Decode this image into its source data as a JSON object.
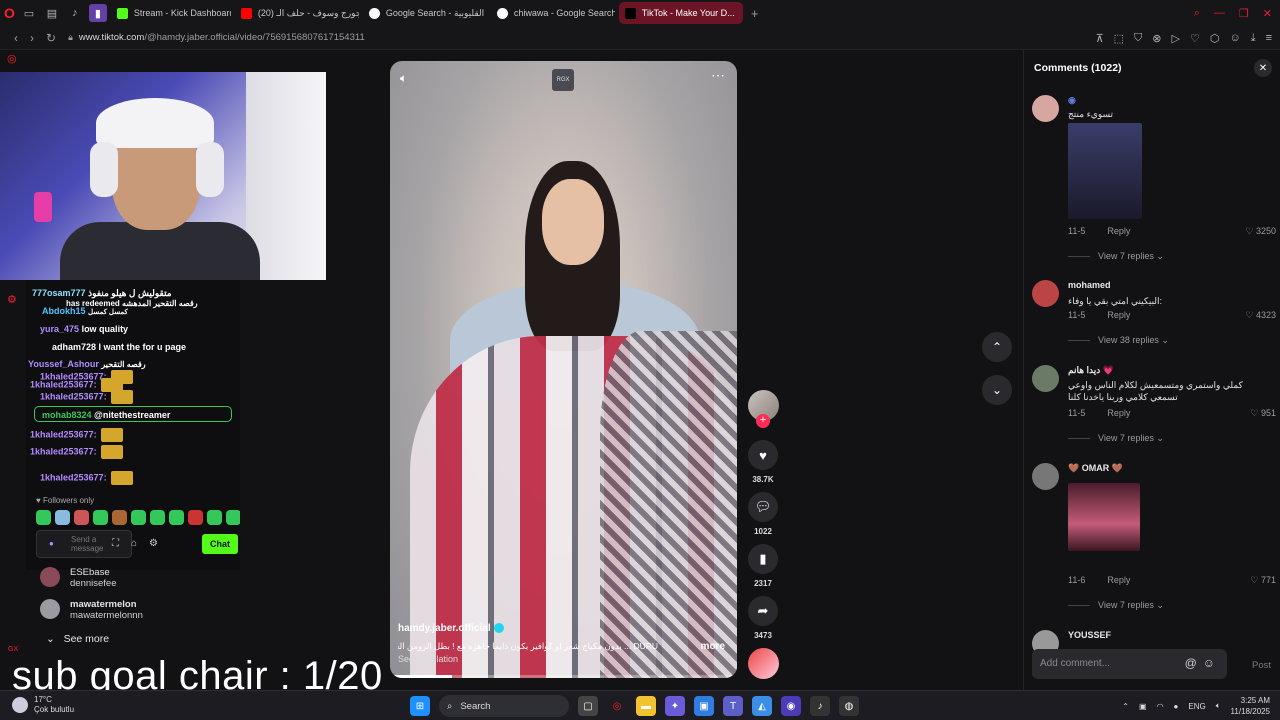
{
  "browser": {
    "tabs": [
      {
        "label": "Stream - Kick Dashboard",
        "color": "#53fc18",
        "active": false
      },
      {
        "label": "(20) جورج وسوف - حلف الـ...",
        "color": "#ff0000",
        "active": false
      },
      {
        "label": "Google Search - القليوبية",
        "color": "#4285f4",
        "active": false
      },
      {
        "label": "chiwawa - Google Search",
        "color": "#4285f4",
        "active": false
      },
      {
        "label": "TikTok - Make Your D...",
        "color": "#000000",
        "active": true
      }
    ],
    "url_host": "www.tiktok.com",
    "url_path": "/@hamdy.jaber.official/video/7569156807617154311",
    "accent": "#ff1b2d"
  },
  "stream_chat": {
    "lines": [
      {
        "user": "777osam777",
        "text": "متقولیش ل هیلو منفوذ",
        "color": "#8de0ff"
      },
      {
        "user": "",
        "text": "has redeemed رقصه التقحير المدهشه",
        "color": "#ffffff"
      },
      {
        "user": "Abdokh15",
        "text": "كمسل كمسل",
        "color": "#4fc3ff"
      },
      {
        "user": "yura_475",
        "text": "low quality",
        "color": "#b38bff"
      },
      {
        "user": "adham728",
        "text": "I want the for u page",
        "color": "#ffffff"
      },
      {
        "user": "Youssef_Ashour",
        "text": "رقصه التقحير",
        "color": "#b38bff"
      },
      {
        "user": "1khaled253677",
        "text": "",
        "color": "#b38bff"
      },
      {
        "user": "1khaled253677",
        "text": "",
        "color": "#b38bff"
      },
      {
        "user": "1khaled253677",
        "text": "",
        "color": "#b38bff"
      },
      {
        "user": "mohab8324",
        "text": "@nitethestreamer",
        "color": "#3bc65a"
      },
      {
        "user": "1khaled253677",
        "text": "",
        "color": "#b38bff"
      },
      {
        "user": "1khaled253677",
        "text": "",
        "color": "#b38bff"
      },
      {
        "user": "1khaled253677",
        "text": "",
        "color": "#b38bff"
      }
    ],
    "followers_only": "Followers only",
    "input_placeholder": "Send a message",
    "chat_button": "Chat"
  },
  "suggested": [
    {
      "name": "ESEbase",
      "handle": "dennisefee"
    },
    {
      "name": "mawatermelon",
      "handle": "mawatermelonnn"
    }
  ],
  "see_more": "See more",
  "overlay_text": "sub goal chair : 1/20",
  "video": {
    "author": "hamdy.jaber.official",
    "caption": "DURU ... بدون مكياج شعر او كوافير بكون دايما جاهزة مع ! بطل الزومن الجديد",
    "more": "more",
    "see_translation": "See translation",
    "logo_text": "RGX",
    "progress": 0.18
  },
  "actions": {
    "likes": "38.7K",
    "comments": "1022",
    "saves": "2317",
    "shares": "3473"
  },
  "comments_panel": {
    "title": "Comments (1022)",
    "items": [
      {
        "name": "",
        "text": "تسويء منتج",
        "date": "11-5",
        "reply": "Reply",
        "likes": "3250",
        "view_replies": "View 7 replies",
        "image": true
      },
      {
        "name": "mohamed",
        "text": "البيكيني امتي بقي يا وفاء:",
        "date": "11-5",
        "reply": "Reply",
        "likes": "4323",
        "view_replies": "View 38 replies",
        "image": false
      },
      {
        "name": "ديدا هانم 💗",
        "text": "كملي واستمري ومتسمعيش لكلام الناس واوعي تسمعي كلامي وربنا ياخدنا كلنا",
        "date": "11-5",
        "reply": "Reply",
        "likes": "951",
        "view_replies": "View 7 replies",
        "image": false
      },
      {
        "name": "🤎 OMAR 🤎",
        "text": "",
        "date": "11-6",
        "reply": "Reply",
        "likes": "771",
        "view_replies": "View 7 replies",
        "image": true
      },
      {
        "name": "YOUSSEF",
        "text": "",
        "date": "",
        "reply": "",
        "likes": "",
        "view_replies": "",
        "image": false
      }
    ],
    "add_placeholder": "Add comment...",
    "post": "Post"
  },
  "taskbar": {
    "temp": "17°C",
    "weather": "Çok bulutlu",
    "search": "Search",
    "lang": "ENG",
    "time": "3:25 AM",
    "date": "11/18/2025"
  }
}
